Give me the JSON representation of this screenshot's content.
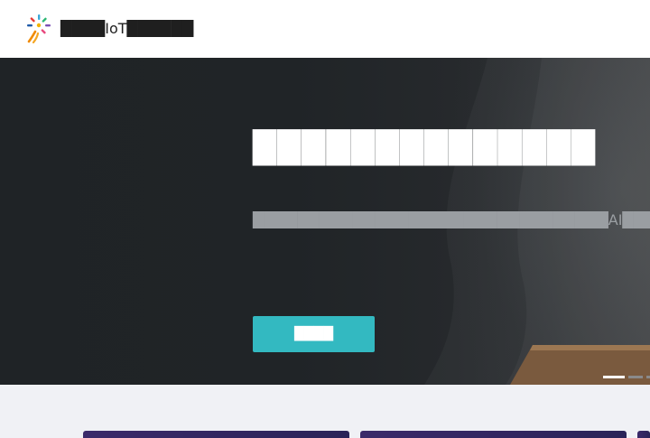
{
  "header": {
    "brand_name": "████IoT██████",
    "logo_icon": "flower-burst-logo"
  },
  "hero": {
    "title": "██████████████",
    "description": "████████████████████████████████AI████████████",
    "cta_label": "████",
    "accent_color": "#33b9c1",
    "background_color": "#202427"
  },
  "carousel": {
    "slide_count": 3,
    "active_index": 0
  }
}
